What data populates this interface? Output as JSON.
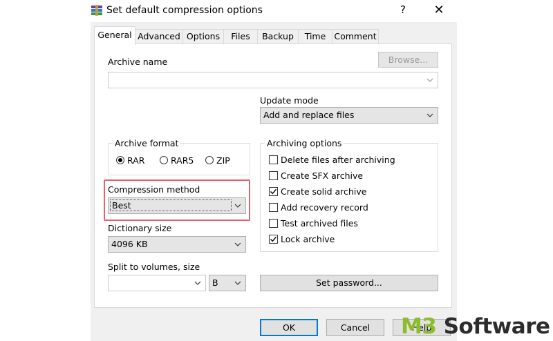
{
  "window": {
    "title": "Set default compression options",
    "help_glyph": "?",
    "close_glyph": "✕"
  },
  "tabs": [
    {
      "label": "General",
      "active": true
    },
    {
      "label": "Advanced"
    },
    {
      "label": "Options"
    },
    {
      "label": "Files"
    },
    {
      "label": "Backup"
    },
    {
      "label": "Time"
    },
    {
      "label": "Comment"
    }
  ],
  "archive_name": {
    "label": "Archive name",
    "value": "",
    "browse_label": "Browse..."
  },
  "update_mode": {
    "label": "Update mode",
    "value": "Add and replace files"
  },
  "archive_format": {
    "legend": "Archive format",
    "options": [
      {
        "label": "RAR",
        "selected": true
      },
      {
        "label": "RAR5",
        "selected": false
      },
      {
        "label": "ZIP",
        "selected": false
      }
    ]
  },
  "compression_method": {
    "label": "Compression method",
    "value": "Best"
  },
  "dictionary_size": {
    "label": "Dictionary size",
    "value": "4096 KB"
  },
  "split_volumes": {
    "label": "Split to volumes, size",
    "value": "",
    "unit": "B"
  },
  "archiving_options": {
    "legend": "Archiving options",
    "items": [
      {
        "label": "Delete files after archiving",
        "checked": false
      },
      {
        "label": "Create SFX archive",
        "checked": false
      },
      {
        "label": "Create solid archive",
        "checked": true
      },
      {
        "label": "Add recovery record",
        "checked": false
      },
      {
        "label": "Test archived files",
        "checked": false
      },
      {
        "label": "Lock archive",
        "checked": true
      }
    ]
  },
  "set_password_label": "Set password...",
  "footer": {
    "ok_label": "OK",
    "cancel_label": "Cancel",
    "help_label": "Help"
  },
  "watermark": {
    "prefix": "M3",
    "text": "Software"
  },
  "colors": {
    "highlight_border": "#e2636a",
    "default_button_border": "#0078d7",
    "watermark_green": "#8bbd2c"
  }
}
